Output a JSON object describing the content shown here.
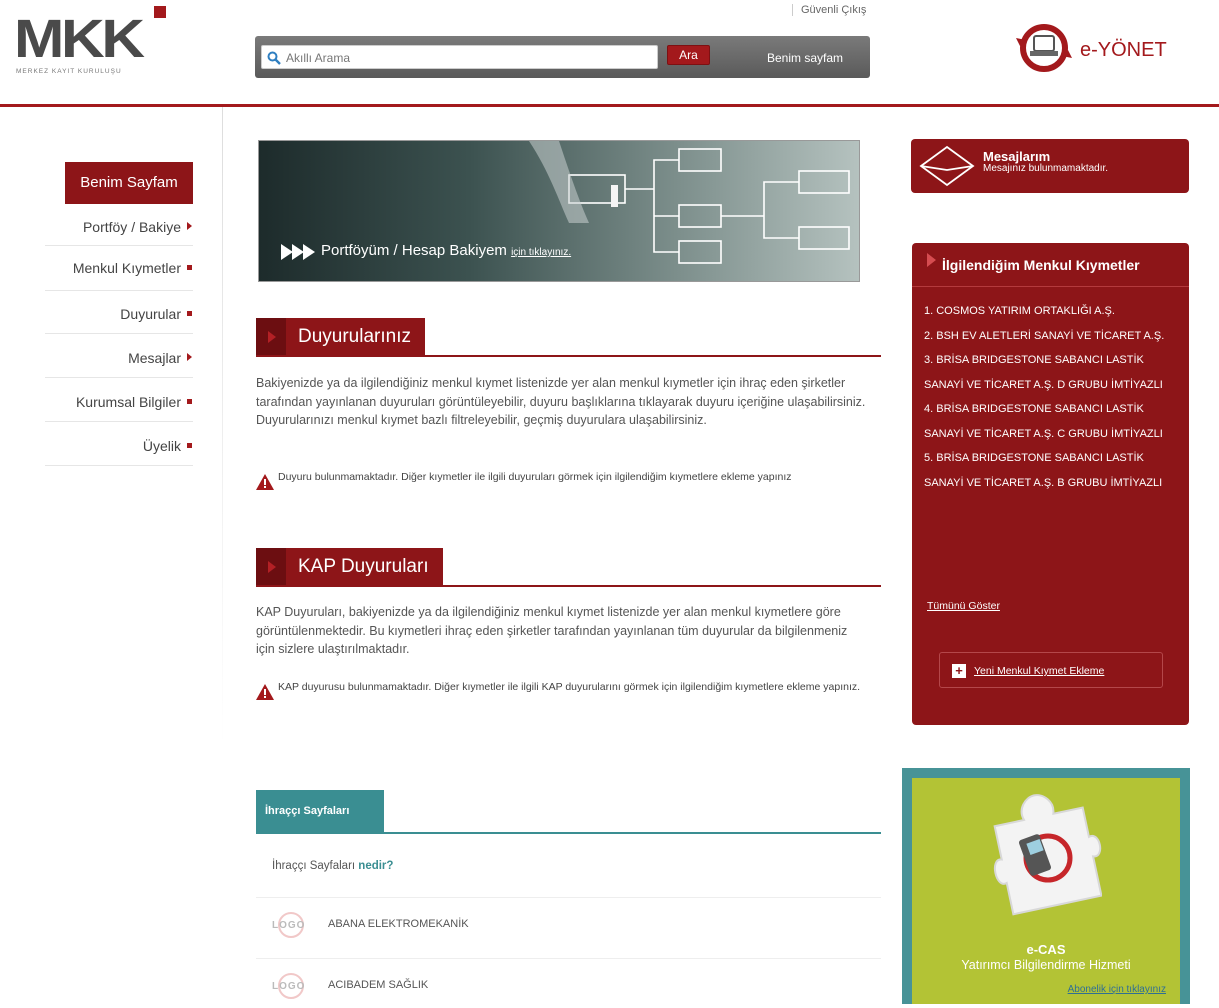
{
  "header": {
    "logo_text": "MKK",
    "logo_subtitle": "MERKEZ KAYIT KURULUŞU",
    "safe_exit": "Güvenli Çıkış",
    "search_placeholder": "Akıllı Arama",
    "search_button": "Ara",
    "my_page_link": "Benim sayfam",
    "eyonet_label": "e-YÖNET"
  },
  "colors": {
    "brand_red": "#8d1518",
    "teal": "#3a8e92",
    "ecas_green": "#b3c335"
  },
  "nav": {
    "active": "Benim Sayfam",
    "items": [
      {
        "label": "Portföy / Bakiye",
        "marker": "arrow"
      },
      {
        "label": "Menkul Kıymetler",
        "marker": "square"
      },
      {
        "label": "Duyurular",
        "marker": "square"
      },
      {
        "label": "Mesajlar",
        "marker": "arrow"
      },
      {
        "label": "Kurumsal Bilgiler",
        "marker": "square"
      },
      {
        "label": "Üyelik",
        "marker": "square"
      }
    ]
  },
  "banner": {
    "main": "Portföyüm / Hesap Bakiyem",
    "sub": "için tıklayınız."
  },
  "announcements": {
    "title": "Duyurularınız",
    "text": "Bakiyenizde ya da ilgilendiğiniz menkul kıymet listenizde yer alan menkul kıymetler için ihraç eden şirketler tarafından yayınlanan duyuruları görüntüleyebilir, duyuru başlıklarına tıklayarak duyuru içeriğine ulaşabilirsiniz. Duyurularınızı menkul kıymet bazlı filtreleyebilir, geçmiş duyurulara ulaşabilirsiniz.",
    "warning": "Duyuru bulunmamaktadır. Diğer kıymetler ile ilgili duyuruları görmek için ilgilendiğim kıymetlere ekleme yapınız"
  },
  "kap": {
    "title": "KAP Duyuruları",
    "text": "KAP Duyuruları, bakiyenizde ya da ilgilendiğiniz menkul kıymet listenizde yer alan menkul kıymetlere göre görüntülenmektedir. Bu kıymetleri ihraç eden şirketler tarafından yayınlanan tüm duyurular da bilgilenmeniz için sizlere ulaştırılmaktadır.",
    "warning": "KAP duyurusu bulunmamaktadır. Diğer kıymetler ile ilgili KAP duyurularını görmek için ilgilendiğim kıymetlere ekleme yapınız."
  },
  "issuers": {
    "tab": "İhraççı Sayfaları",
    "question_prefix": "İhraççı Sayfaları",
    "question_link": "nedir?",
    "logo_placeholder": "LOGO",
    "rows": [
      "ABANA ELEKTROMEKANİK",
      "ACIBADEM SAĞLIK"
    ]
  },
  "messages": {
    "title": "Mesajlarım",
    "subtitle": "Mesajınız bulunmamaktadır."
  },
  "interests": {
    "title": "İlgilendiğim Menkul Kıymetler",
    "items": [
      "1. COSMOS YATIRIM ORTAKLIĞI A.Ş.",
      "2. BSH EV ALETLERİ SANAYİ VE TİCARET A.Ş.",
      "3. BRİSA BRIDGESTONE SABANCI LASTİK SANAYİ VE TİCARET A.Ş. D GRUBU İMTİYAZLI",
      "4. BRİSA BRIDGESTONE SABANCI LASTİK SANAYİ VE TİCARET A.Ş. C GRUBU İMTİYAZLI",
      "5. BRİSA BRIDGESTONE SABANCI LASTİK SANAYİ VE TİCARET A.Ş. B GRUBU İMTİYAZLI"
    ],
    "show_all": "Tümünü Göster",
    "add_new": "Yeni Menkul Kıymet Ekleme"
  },
  "ecas": {
    "title": "e-CAS",
    "subtitle": "Yatırımcı Bilgilendirme Hizmeti",
    "link": "Abonelik için tıklayınız"
  }
}
